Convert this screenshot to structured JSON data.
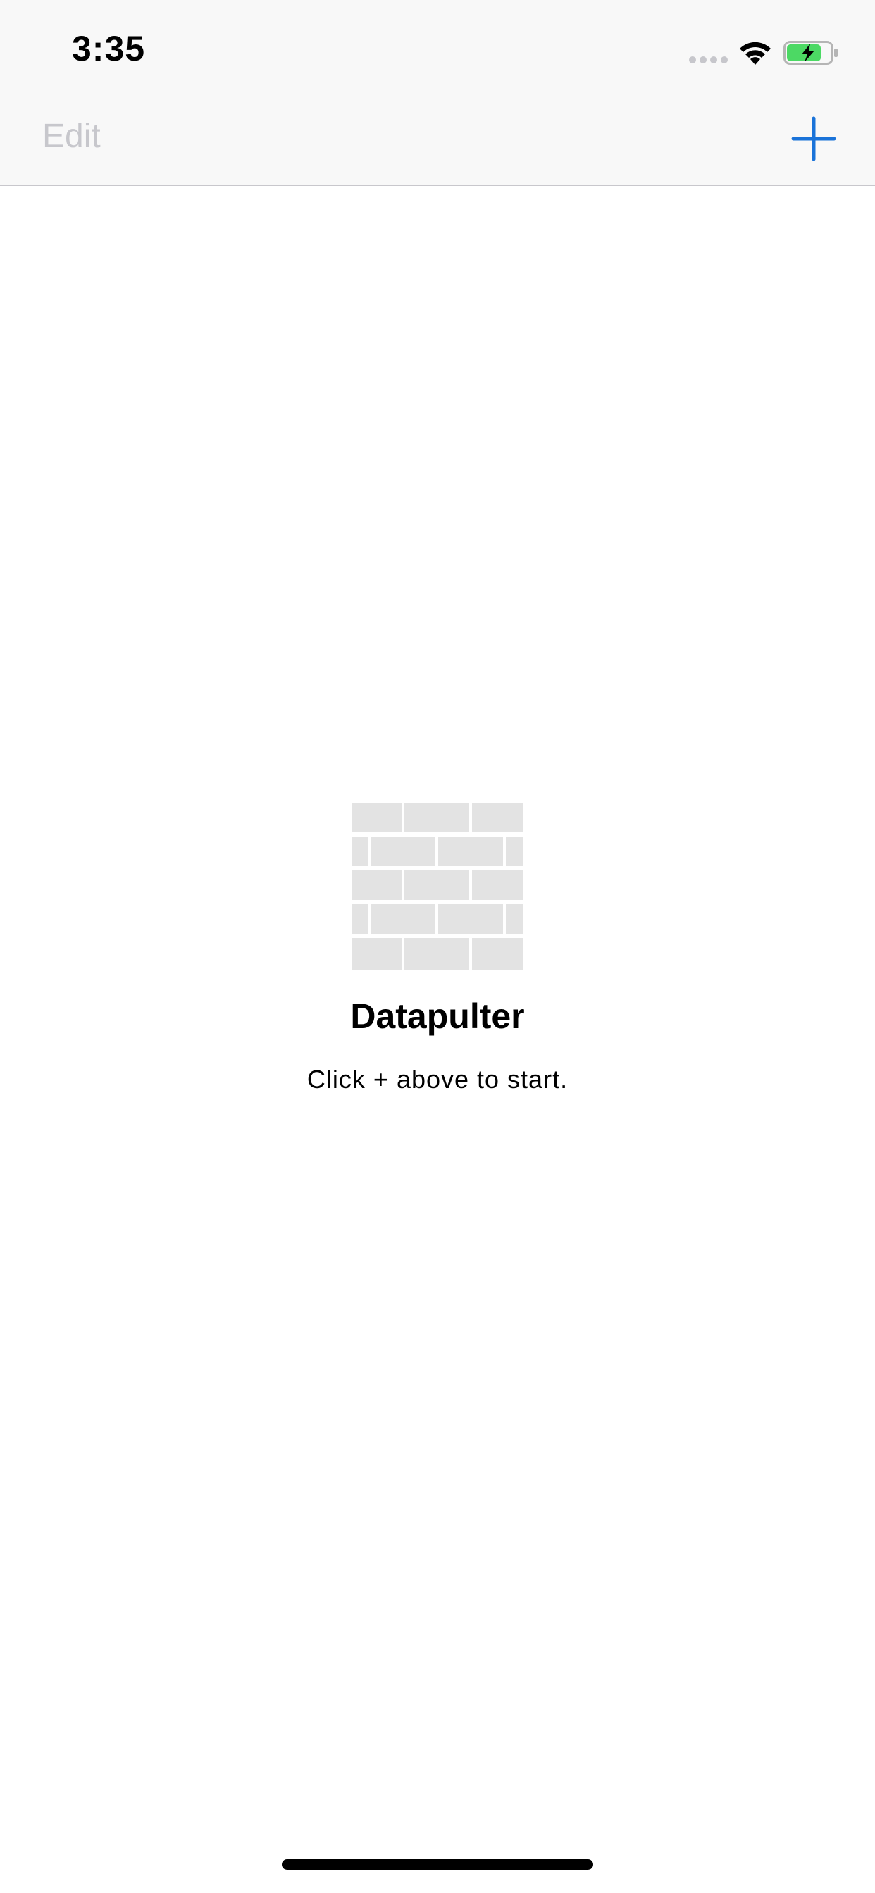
{
  "status_bar": {
    "time": "3:35",
    "battery_color": "#4cd964"
  },
  "nav_bar": {
    "edit_label": "Edit",
    "add_icon": "plus-icon",
    "accent_color": "#1a73d9"
  },
  "empty_state": {
    "icon": "brick-wall-icon",
    "title": "Datapulter",
    "subtitle": "Click + above to start."
  }
}
